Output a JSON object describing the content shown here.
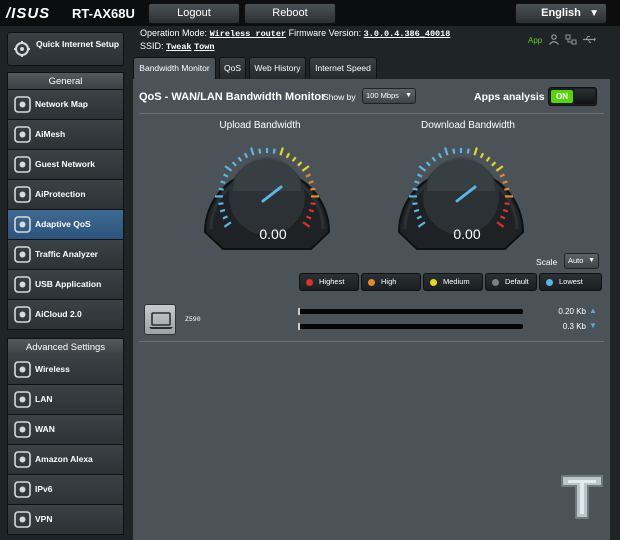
{
  "header": {
    "logo": "/ISUS",
    "model": "RT-AX68U",
    "logout_label": "Logout",
    "reboot_label": "Reboot",
    "language": "English",
    "operation_mode_label": "Operation Mode:",
    "operation_mode_value": "Wireless router",
    "firmware_label": "Firmware Version:",
    "firmware_value": "3.0.0.4.386_40018",
    "ssid_label": "SSID:",
    "ssid_1": "Tweak",
    "ssid_2": "Town",
    "app_label": "App"
  },
  "sidebar": {
    "quick_internet_setup": "Quick Internet Setup",
    "general_title": "General",
    "general_items": [
      {
        "label": "Network Map",
        "icon": "network-map-icon"
      },
      {
        "label": "AiMesh",
        "icon": "aimesh-icon"
      },
      {
        "label": "Guest Network",
        "icon": "guest-network-icon"
      },
      {
        "label": "AiProtection",
        "icon": "aiprotection-icon"
      },
      {
        "label": "Adaptive QoS",
        "icon": "adaptive-qos-icon"
      },
      {
        "label": "Traffic Analyzer",
        "icon": "traffic-analyzer-icon"
      },
      {
        "label": "USB Application",
        "icon": "usb-application-icon"
      },
      {
        "label": "AiCloud 2.0",
        "icon": "aicloud-icon"
      }
    ],
    "advanced_title": "Advanced Settings",
    "advanced_items": [
      {
        "label": "Wireless",
        "icon": "wireless-icon"
      },
      {
        "label": "LAN",
        "icon": "lan-icon"
      },
      {
        "label": "WAN",
        "icon": "wan-icon"
      },
      {
        "label": "Amazon Alexa",
        "icon": "amazon-alexa-icon"
      },
      {
        "label": "IPv6",
        "icon": "ipv6-icon"
      },
      {
        "label": "VPN",
        "icon": "vpn-icon"
      }
    ]
  },
  "tabs": [
    "Bandwidth Monitor",
    "QoS",
    "Web History",
    "Internet Speed"
  ],
  "monitor": {
    "title": "QoS - WAN/LAN Bandwidth Monitor",
    "show_by_label": "Show by",
    "show_by_value": "100 Mbps",
    "apps_analysis_label": "Apps analysis",
    "apps_analysis_state": "ON",
    "upload_title": "Upload Bandwidth",
    "download_title": "Download Bandwidth",
    "upload_value": "0.00",
    "download_value": "0.00",
    "scale_label": "Scale",
    "scale_value": "Auto",
    "legend": [
      {
        "label": "Highest",
        "color": "#d8342a"
      },
      {
        "label": "High",
        "color": "#e58a2d"
      },
      {
        "label": "Medium",
        "color": "#e6d52a"
      },
      {
        "label": "Default",
        "color": "#7c8184"
      },
      {
        "label": "Lowest",
        "color": "#5db4e6"
      }
    ],
    "client": {
      "name": "Z590",
      "upload_rate": "0.20 Kb",
      "download_rate": "0.3 Kb",
      "upload_fraction": 0.002,
      "download_fraction": 0.003
    }
  },
  "colors": {
    "accent": "#5db4e6",
    "toggle_on": "#5ad30f",
    "active_nav": "#2c547c"
  }
}
